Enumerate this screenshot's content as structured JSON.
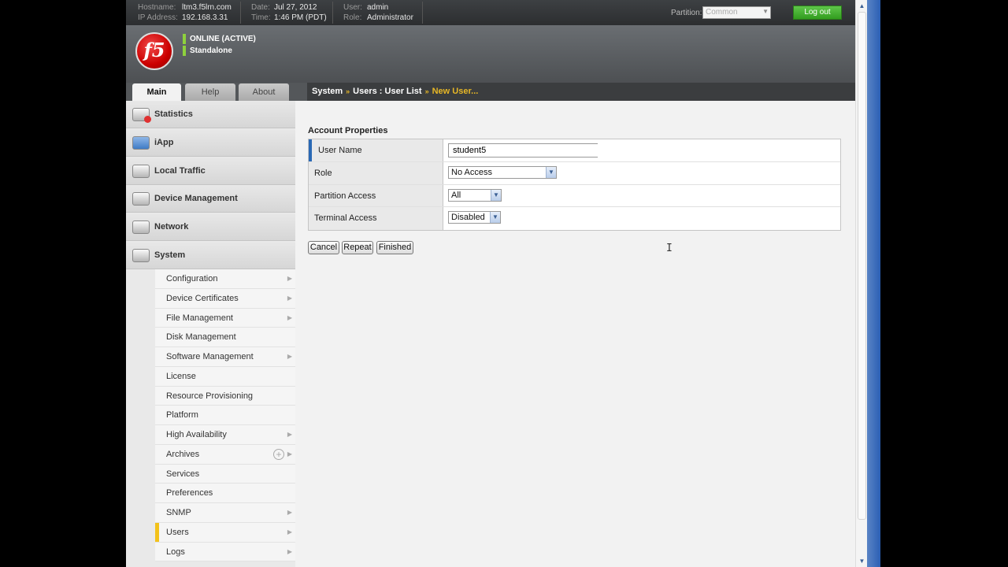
{
  "topbar": {
    "hostname_label": "Hostname:",
    "hostname": "ltm3.f5lrn.com",
    "ip_label": "IP Address:",
    "ip": "192.168.3.31",
    "date_label": "Date:",
    "date": "Jul 27, 2012",
    "time_label": "Time:",
    "time": "1:46 PM (PDT)",
    "user_label": "User:",
    "user": "admin",
    "role_label": "Role:",
    "role": "Administrator",
    "partition_label": "Partition:",
    "partition_value": "Common",
    "logout_label": "Log out"
  },
  "header": {
    "logo_text": "f5",
    "status": "ONLINE (ACTIVE)",
    "mode": "Standalone"
  },
  "tabs": [
    "Main",
    "Help",
    "About"
  ],
  "breadcrumb": {
    "system": "System",
    "users": "Users : User List",
    "current": "New User...",
    "sep": "»"
  },
  "sidebar": {
    "items": [
      "Statistics",
      "iApp",
      "Local Traffic",
      "Device Management",
      "Network",
      "System"
    ],
    "submenu": [
      "Configuration",
      "Device Certificates",
      "File Management",
      "Disk Management",
      "Software Management",
      "License",
      "Resource Provisioning",
      "Platform",
      "High Availability",
      "Archives",
      "Services",
      "Preferences",
      "SNMP",
      "Users",
      "Logs"
    ]
  },
  "form": {
    "section_title": "Account Properties",
    "rows": {
      "user_name": {
        "label": "User Name",
        "value": "student5"
      },
      "role": {
        "label": "Role",
        "value": "No Access"
      },
      "partition_access": {
        "label": "Partition Access",
        "value": "All"
      },
      "terminal_access": {
        "label": "Terminal Access",
        "value": "Disabled"
      }
    },
    "buttons": {
      "cancel": "Cancel",
      "repeat": "Repeat",
      "finished": "Finished"
    }
  },
  "colors": {
    "accent_yellow": "#e7b726",
    "status_green": "#8ed13d",
    "logout_green": "#329d1f",
    "required_blue": "#2a69b5",
    "logo_red": "#cc0000"
  }
}
